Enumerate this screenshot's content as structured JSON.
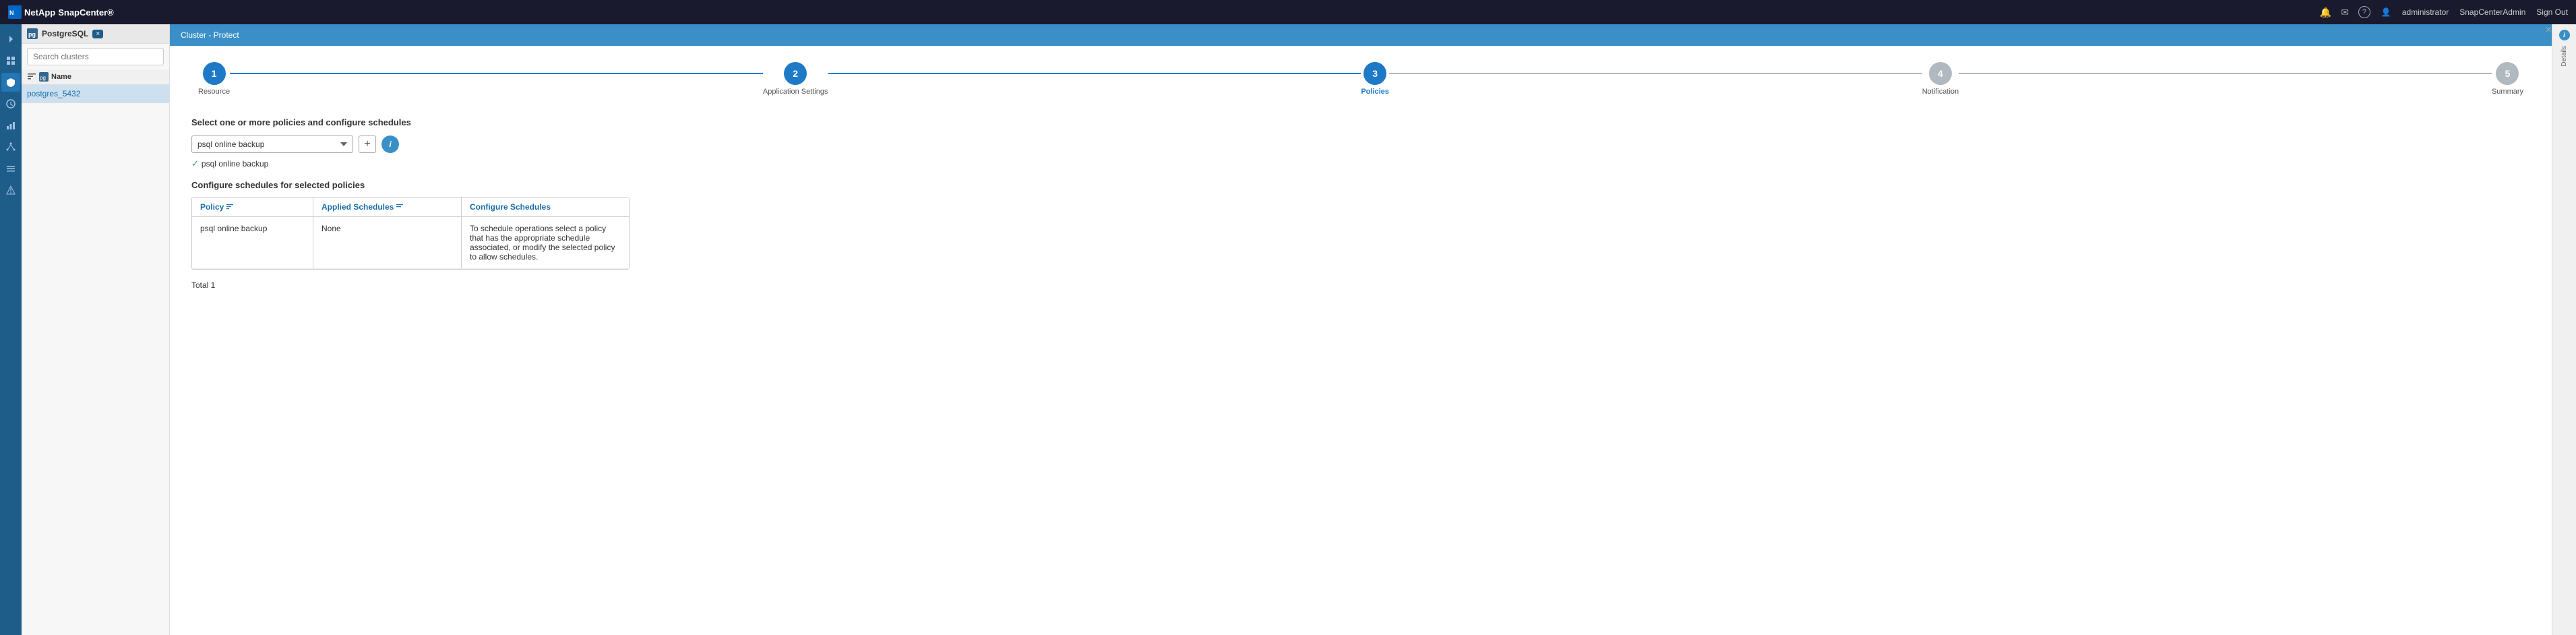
{
  "app": {
    "title": "SnapCenter®",
    "brand": "NetApp"
  },
  "topnav": {
    "notification_icon": "🔔",
    "mail_icon": "✉",
    "help_icon": "?",
    "user_icon": "👤",
    "user_label": "administrator",
    "admin_label": "SnapCenterAdmin",
    "signout_label": "Sign Out",
    "close_label": "×"
  },
  "sidebar": {
    "header_label": "PostgreSQL",
    "badge_label": "×",
    "search_placeholder": "Search clusters",
    "table_header": "Name",
    "items": [
      {
        "label": "postgres_5432"
      }
    ]
  },
  "breadcrumb": {
    "text": "Cluster - Protect"
  },
  "wizard": {
    "steps": [
      {
        "number": "1",
        "label": "Resource",
        "state": "completed"
      },
      {
        "number": "2",
        "label": "Application Settings",
        "state": "completed"
      },
      {
        "number": "3",
        "label": "Policies",
        "state": "active"
      },
      {
        "number": "4",
        "label": "Notification",
        "state": "inactive"
      },
      {
        "number": "5",
        "label": "Summary",
        "state": "inactive"
      }
    ]
  },
  "policy_section": {
    "title": "Select one or more policies and configure schedules",
    "dropdown_value": "psql online backup",
    "add_button_label": "+",
    "info_button_label": "i",
    "tag_label": "psql online backup",
    "schedules_title": "Configure schedules for selected policies",
    "table": {
      "col_policy": "Policy",
      "col_applied": "Applied Schedules",
      "col_configure": "Configure Schedules",
      "rows": [
        {
          "policy": "psql online backup",
          "applied": "None",
          "configure": "To schedule operations select a policy that has the appropriate schedule associated, or modify the selected policy to allow schedules."
        }
      ]
    },
    "total_label": "Total 1"
  },
  "right_panel": {
    "label": "Details",
    "info_icon": "i"
  },
  "colors": {
    "accent_blue": "#1e7ac7",
    "nav_bg": "#1a1a2e",
    "sidebar_bg": "#1e5c8a",
    "breadcrumb_bg": "#3a8fc7"
  }
}
